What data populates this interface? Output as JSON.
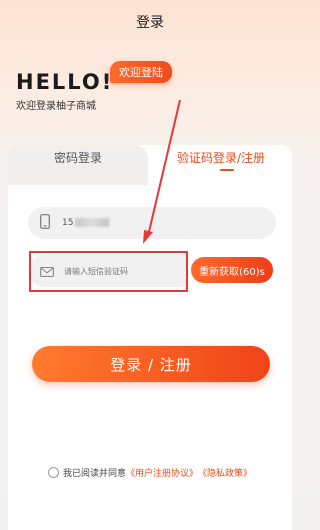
{
  "header": {
    "title": "登录"
  },
  "hero": {
    "hello": "HELLO!",
    "welcome_badge": "欢迎登陆",
    "subtitle": "欢迎登录柚子商城"
  },
  "tabs": {
    "password": "密码登录",
    "sms": "验证码登录/注册"
  },
  "phone": {
    "value_prefix": "15",
    "icon": "phone-icon"
  },
  "code": {
    "placeholder": "请输入短信验证码",
    "icon": "mail-icon"
  },
  "get_code_button": "重新获取(60)s",
  "submit_button": "登录 / 注册",
  "agreement": {
    "prefix": "我已阅读并同意",
    "user_agreement": "《用户注册协议》",
    "privacy_policy": "《隐私政策》"
  },
  "colors": {
    "accent": "#ef4a1c",
    "annotation": "#e53935"
  }
}
